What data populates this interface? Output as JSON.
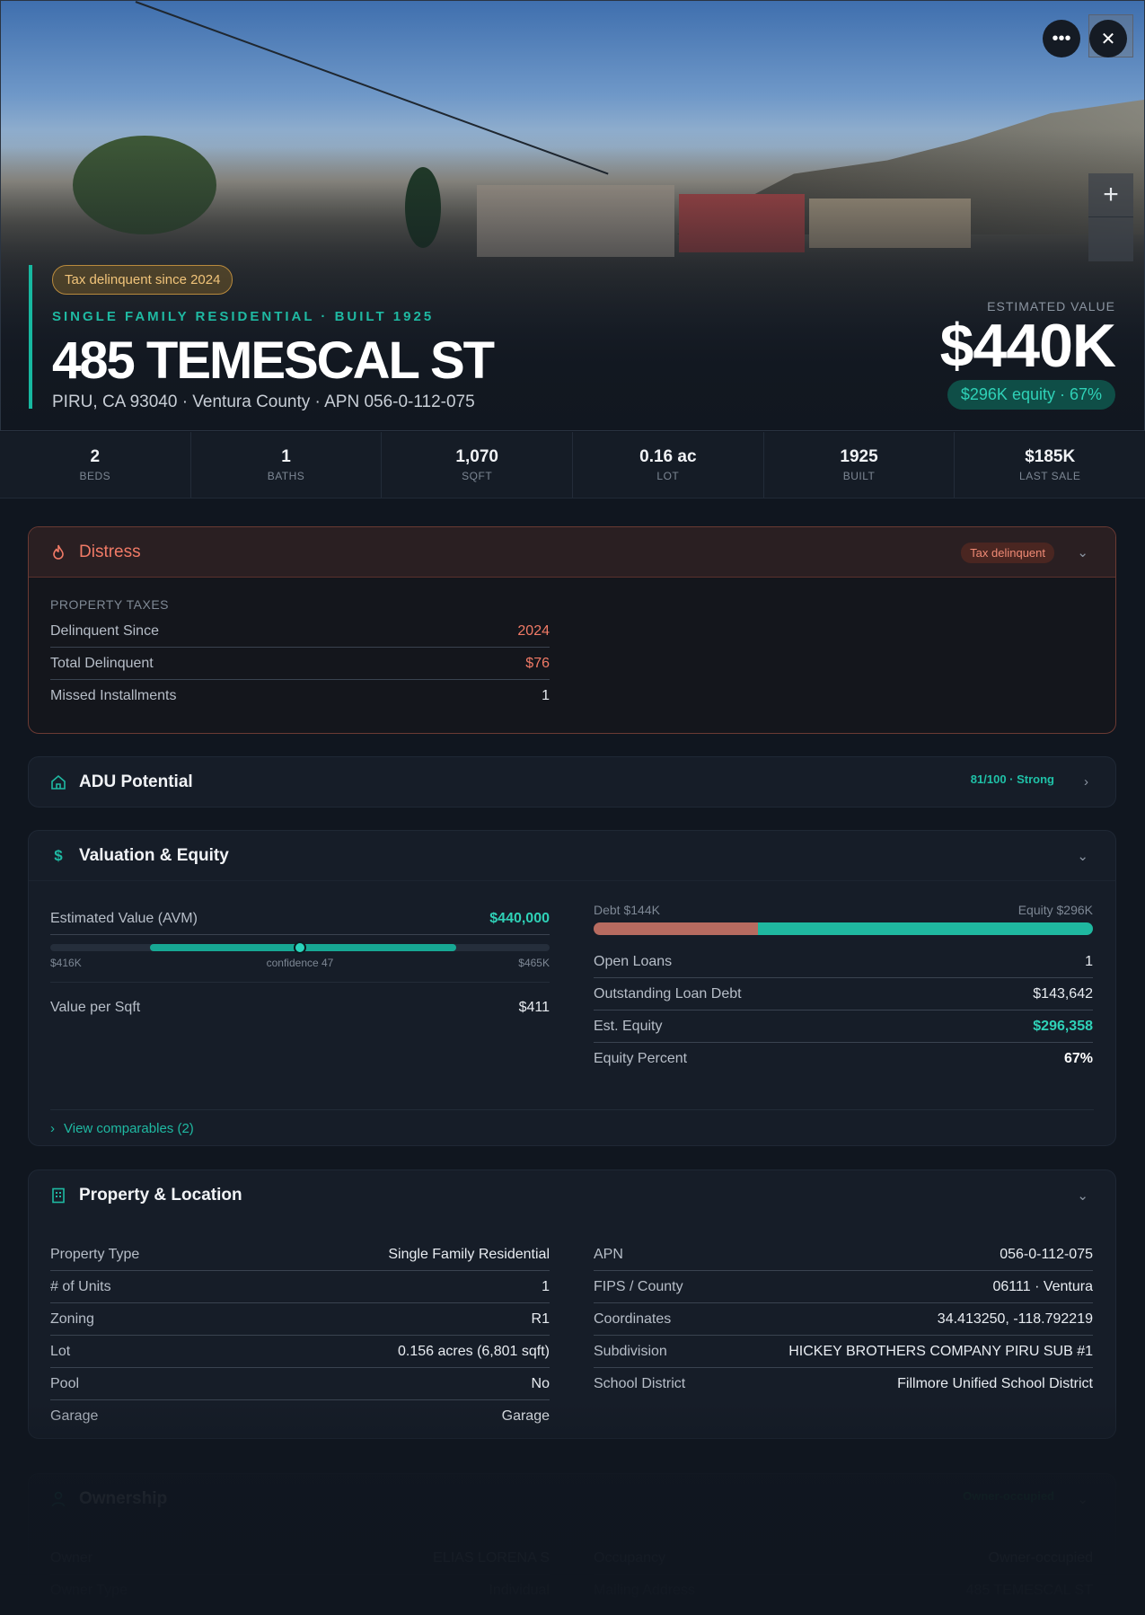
{
  "hero": {
    "tax_badge": "Tax delinquent since 2024",
    "subtitle": "SINGLE FAMILY RESIDENTIAL · BUILT 1925",
    "address": "485 TEMESCAL ST",
    "location_line": "PIRU, CA 93040 · Ventura County · APN 056-0-112-075",
    "estimated_label": "ESTIMATED VALUE",
    "estimated_value": "$440K",
    "equity_pill": "$296K equity · 67%",
    "more_icon": "ellipsis-icon",
    "close_icon": "close-icon",
    "zoom_icon": "plus-icon"
  },
  "stats": [
    {
      "value": "2",
      "label": "BEDS"
    },
    {
      "value": "1",
      "label": "BATHS"
    },
    {
      "value": "1,070",
      "label": "SQFT"
    },
    {
      "value": "0.16 ac",
      "label": "LOT"
    },
    {
      "value": "1925",
      "label": "BUILT"
    },
    {
      "value": "$185K",
      "label": "LAST SALE"
    }
  ],
  "distress": {
    "title": "Distress",
    "badge": "Tax delinquent",
    "section_label": "PROPERTY TAXES",
    "rows": [
      {
        "k": "Delinquent Since",
        "v": "2024"
      },
      {
        "k": "Total Delinquent",
        "v": "$76"
      },
      {
        "k": "Missed Installments",
        "v": "1"
      }
    ]
  },
  "adu": {
    "title": "ADU Potential",
    "badge": "81/100 · Strong"
  },
  "valuation": {
    "title": "Valuation & Equity",
    "avm_label": "Estimated Value (AVM)",
    "avm_value": "$440,000",
    "range_low": "$416K",
    "range_mid": "confidence 47",
    "range_high": "$465K",
    "range_low_num": 416000,
    "range_high_num": 465000,
    "range_scale_min": 400000,
    "range_scale_max": 480000,
    "avm_num": 440000,
    "value_per_sqft_label": "Value per Sqft",
    "value_per_sqft": "$411",
    "debt_label": "Debt $144K",
    "equity_label": "Equity $296K",
    "debt_fraction": 0.33,
    "rows": [
      {
        "k": "Open Loans",
        "v": "1"
      },
      {
        "k": "Outstanding Loan Debt",
        "v": "$143,642"
      },
      {
        "k": "Est. Equity",
        "v": "$296,358"
      },
      {
        "k": "Equity Percent",
        "v": "67%"
      }
    ],
    "comparables_link": "View comparables (2)"
  },
  "property": {
    "title": "Property & Location",
    "left": [
      {
        "k": "Property Type",
        "v": "Single Family Residential"
      },
      {
        "k": "# of Units",
        "v": "1"
      },
      {
        "k": "Zoning",
        "v": "R1"
      },
      {
        "k": "Lot",
        "v": "0.156 acres (6,801 sqft)"
      },
      {
        "k": "Pool",
        "v": "No"
      },
      {
        "k": "Garage",
        "v": "Garage"
      }
    ],
    "right": [
      {
        "k": "APN",
        "v": "056-0-112-075"
      },
      {
        "k": "FIPS / County",
        "v": "06111 · Ventura"
      },
      {
        "k": "Coordinates",
        "v": "34.413250, -118.792219"
      },
      {
        "k": "Subdivision",
        "v": "HICKEY BROTHERS COMPANY PIRU SUB #1"
      },
      {
        "k": "School District",
        "v": "Fillmore Unified School District"
      }
    ]
  },
  "ownership": {
    "title": "Ownership",
    "badge": "Owner-occupied",
    "left": [
      {
        "k": "Owner",
        "v": "ELIAS LORENA S"
      },
      {
        "k": "Owner Type",
        "v": "Individual"
      }
    ],
    "right": [
      {
        "k": "Occupancy",
        "v": "Owner-occupied"
      },
      {
        "k": "Mailing Address",
        "v": "485 TEMESCAL ST"
      }
    ]
  },
  "colors": {
    "accent": "#1fb9a2",
    "distress": "#f07a66",
    "background": "#10161f"
  }
}
